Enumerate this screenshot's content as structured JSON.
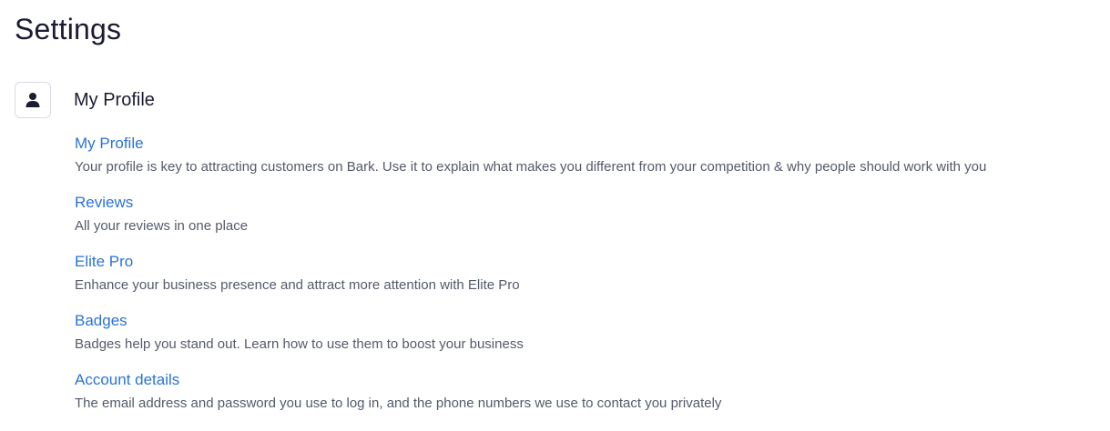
{
  "page": {
    "title": "Settings"
  },
  "section": {
    "icon": "person-icon",
    "title": "My Profile"
  },
  "items": [
    {
      "label": "My Profile",
      "description": "Your profile is key to attracting customers on Bark. Use it to explain what makes you different from your competition & why people should work with you"
    },
    {
      "label": "Reviews",
      "description": "All your reviews in one place"
    },
    {
      "label": "Elite Pro",
      "description": "Enhance your business presence and attract more attention with Elite Pro"
    },
    {
      "label": "Badges",
      "description": "Badges help you stand out. Learn how to use them to boost your business"
    },
    {
      "label": "Account details",
      "description": "The email address and password you use to log in, and the phone numbers we use to contact you privately"
    }
  ],
  "colors": {
    "link": "#2a73d9",
    "text": "#1b1b33",
    "muted": "#555a6b",
    "border": "#d9dbe3"
  }
}
